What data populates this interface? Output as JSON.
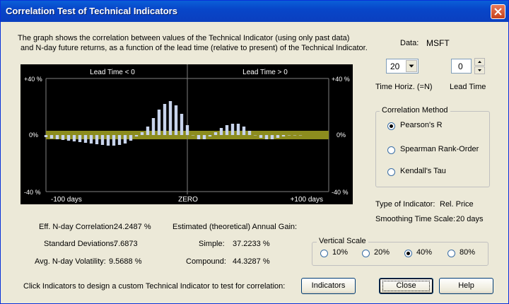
{
  "window": {
    "title": "Correlation Test of Technical Indicators"
  },
  "description": {
    "line1": "The graph shows the correlation between values of the Technical Indicator (using only past data)",
    "line2": "and N-day future returns, as a function of the lead time (relative to present) of the Technical Indicator."
  },
  "chart_data": {
    "type": "bar",
    "title": "",
    "region_labels": [
      "Lead Time < 0",
      "Lead Time > 0"
    ],
    "x_tick_labels": [
      "-100 days",
      "ZERO",
      "+100 days"
    ],
    "y_tick_labels_left": [
      "+40 %",
      "0%",
      "-40 %"
    ],
    "y_tick_labels_right": [
      "+40 %",
      "0%",
      "-40 %"
    ],
    "xlim": [
      -100,
      100
    ],
    "ylim": [
      -40,
      40
    ],
    "band": [
      -3,
      3
    ],
    "colors": {
      "bars": "#c8d4ec",
      "band": "#8c8c1e",
      "grid": "#808080",
      "text": "#ffffff"
    },
    "x": [
      -100,
      -96,
      -92,
      -88,
      -84,
      -80,
      -76,
      -72,
      -68,
      -64,
      -60,
      -56,
      -52,
      -48,
      -44,
      -40,
      -36,
      -32,
      -28,
      -24,
      -20,
      -16,
      -12,
      -8,
      -4,
      0,
      4,
      8,
      12,
      16,
      20,
      24,
      28,
      32,
      36,
      40,
      44,
      48,
      52,
      56,
      60,
      64,
      68,
      72,
      76,
      80
    ],
    "values": [
      -1.5,
      -2.5,
      -3,
      -3.5,
      -4,
      -4.5,
      -5,
      -5.5,
      -6,
      -6.5,
      -7,
      -7.5,
      -7.5,
      -7,
      -6,
      -4,
      -1,
      2,
      6,
      12,
      18,
      22,
      24,
      21,
      15,
      7,
      0,
      -3,
      -3,
      -1,
      2,
      5,
      7,
      8,
      8,
      6,
      3,
      0,
      -2,
      -3,
      -3,
      -2,
      -1,
      0,
      0,
      0
    ]
  },
  "data_panel": {
    "data_label": "Data:",
    "data_value": "MSFT",
    "time_horiz_value": "20",
    "time_horiz_label": "Time Horiz. (=N)",
    "lead_time_value": "0",
    "lead_time_label": "Lead Time"
  },
  "correlation_method": {
    "title": "Correlation Method",
    "options": [
      {
        "label": "Pearson's R",
        "selected": true
      },
      {
        "label": "Spearman Rank-Order",
        "selected": false
      },
      {
        "label": "Kendall's Tau",
        "selected": false
      }
    ]
  },
  "indicator_info": {
    "type_label": "Type of Indicator:",
    "type_value": "Rel. Price",
    "smoothing_label": "Smoothing Time Scale:",
    "smoothing_value": "20 days"
  },
  "stats": {
    "eff_label": "Eff. N-day Correlation:",
    "eff_value": "24.2487 %",
    "std_label": "Standard Deviations:",
    "std_value": "7.6873",
    "vol_label": "Avg. N-day Volatility:",
    "vol_value": "9.5688 %",
    "gain_title": "Estimated (theoretical) Annual Gain:",
    "simple_label": "Simple:",
    "simple_value": "37.2233 %",
    "compound_label": "Compound:",
    "compound_value": "44.3287 %"
  },
  "vertical_scale": {
    "title": "Vertical Scale",
    "options": [
      {
        "label": "10%",
        "selected": false
      },
      {
        "label": "20%",
        "selected": false
      },
      {
        "label": "40%",
        "selected": true
      },
      {
        "label": "80%",
        "selected": false
      }
    ]
  },
  "footer": {
    "hint": "Click Indicators to design a custom Technical Indicator to test for correlation:",
    "indicators_button": "Indicators",
    "close_button": "Close",
    "help_button": "Help"
  }
}
